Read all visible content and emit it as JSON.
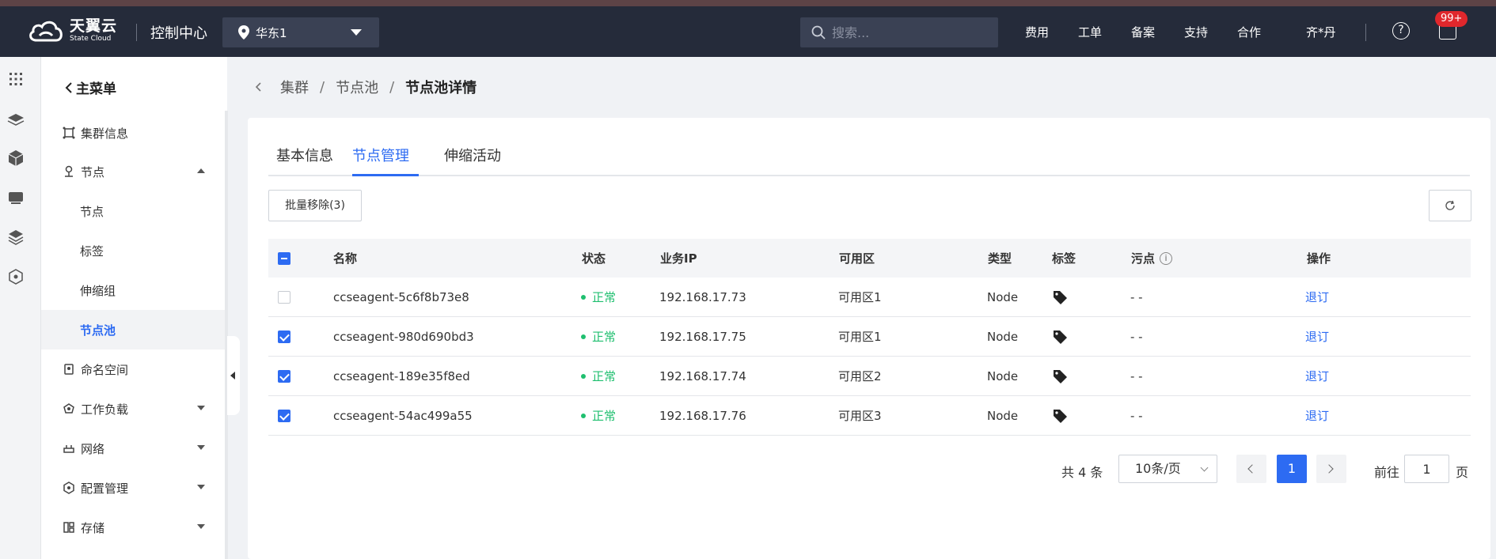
{
  "header": {
    "brand_cn": "天翼云",
    "brand_en": "State Cloud",
    "console_title": "控制中心",
    "region": "华东1",
    "search_placeholder": "搜索...",
    "nav": [
      "费用",
      "工单",
      "备案",
      "支持",
      "合作"
    ],
    "user": "齐*丹",
    "help_icon": "?",
    "message_badge": "99+"
  },
  "sidebar": {
    "main_menu": "主菜单",
    "items": [
      {
        "label": "集群信息"
      },
      {
        "label": "节点"
      },
      {
        "label": "节点"
      },
      {
        "label": "标签"
      },
      {
        "label": "伸缩组"
      },
      {
        "label": "节点池"
      },
      {
        "label": "命名空间"
      },
      {
        "label": "工作负载"
      },
      {
        "label": "网络"
      },
      {
        "label": "配置管理"
      },
      {
        "label": "存储"
      }
    ]
  },
  "breadcrumb": [
    "集群",
    "节点池",
    "节点池详情"
  ],
  "breadcrumb_sep": "/",
  "tabs": [
    "基本信息",
    "节点管理",
    "伸缩活动"
  ],
  "active_tab": "节点管理",
  "toolbar": {
    "batch_remove": "批量移除(3)"
  },
  "table": {
    "columns": [
      "名称",
      "状态",
      "业务IP",
      "可用区",
      "类型",
      "标签",
      "污点",
      "操作"
    ],
    "taint_info_icon": "i",
    "rows": [
      {
        "name": "ccseagent-5c6f8b73e8",
        "status": "正常",
        "ip": "192.168.17.73",
        "zone": "可用区1",
        "type": "Node",
        "taint": "- -",
        "op": "退订",
        "checked": false
      },
      {
        "name": "ccseagent-980d690bd3",
        "status": "正常",
        "ip": "192.168.17.75",
        "zone": "可用区1",
        "type": "Node",
        "taint": "- -",
        "op": "退订",
        "checked": true
      },
      {
        "name": "ccseagent-189e35f8ed",
        "status": "正常",
        "ip": "192.168.17.74",
        "zone": "可用区2",
        "type": "Node",
        "taint": "- -",
        "op": "退订",
        "checked": true
      },
      {
        "name": "ccseagent-54ac499a55",
        "status": "正常",
        "ip": "192.168.17.76",
        "zone": "可用区3",
        "type": "Node",
        "taint": "- -",
        "op": "退订",
        "checked": true
      }
    ]
  },
  "pagination": {
    "total": "共 4 条",
    "page_size": "10条/页",
    "current_page": "1",
    "goto_prefix": "前往",
    "goto_value": "1",
    "goto_suffix": "页"
  },
  "colors": {
    "accent": "#2d6bf2",
    "topbar": "#252b3a",
    "status_ok": "#1fbf6f",
    "badge": "#e0272c"
  }
}
